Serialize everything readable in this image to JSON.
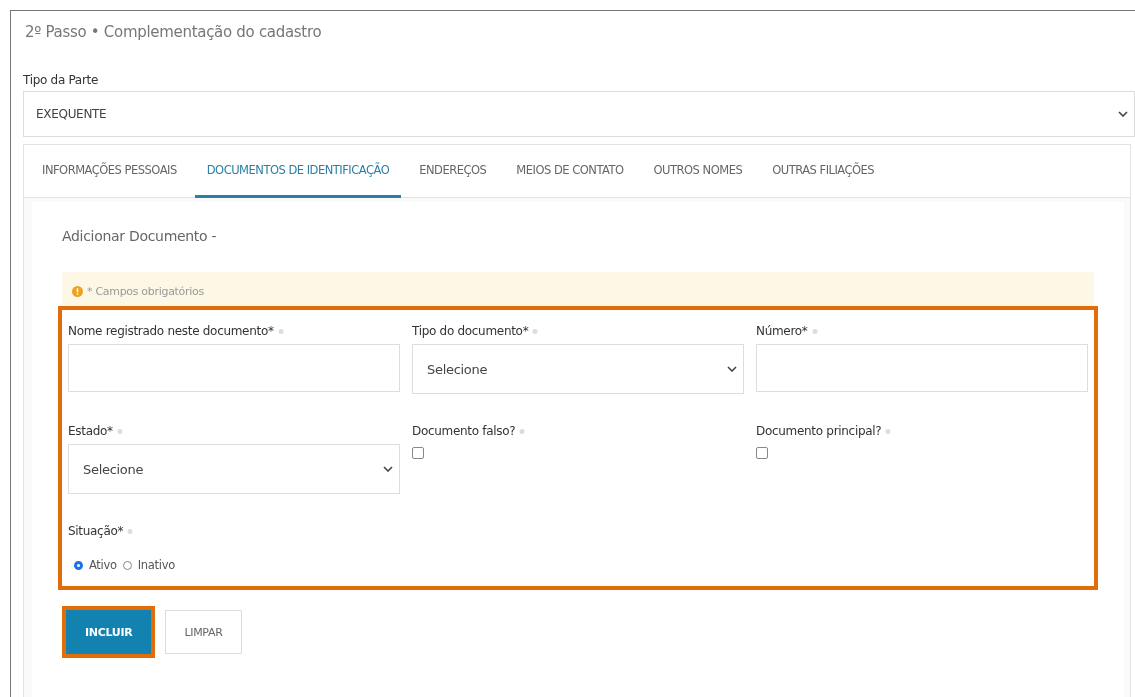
{
  "step_title": "2º Passo • Complementação do cadastro",
  "party_type": {
    "label": "Tipo da Parte",
    "value": "EXEQUENTE"
  },
  "tabs": [
    {
      "label": "INFORMAÇÕES PESSOAIS",
      "selected": false
    },
    {
      "label": "DOCUMENTOS DE IDENTIFICAÇÃO",
      "selected": true
    },
    {
      "label": "ENDEREÇOS",
      "selected": false
    },
    {
      "label": "MEIOS DE CONTATO",
      "selected": false
    },
    {
      "label": "OUTROS NOMES",
      "selected": false
    },
    {
      "label": "OUTRAS FILIAÇÕES",
      "selected": false
    }
  ],
  "card_title": "Adicionar Documento -",
  "notice": "* Campos obrigatórios",
  "fields": [
    {
      "kind": "text",
      "label": "Nome registrado neste documento*"
    },
    {
      "kind": "select",
      "label": "Tipo do documento*",
      "value": "Selecione"
    },
    {
      "kind": "text",
      "label": "Número*"
    },
    {
      "kind": "select",
      "label": "Estado*",
      "value": "Selecione"
    },
    {
      "kind": "checkbox",
      "label": "Documento falso?",
      "checked": false
    },
    {
      "kind": "checkbox",
      "label": "Documento principal?",
      "checked": false
    },
    {
      "kind": "radio",
      "label": "Situação*",
      "options": [
        {
          "label": "Ativo",
          "selected": true
        },
        {
          "label": "Inativo",
          "selected": false
        }
      ]
    }
  ],
  "buttons": [
    {
      "label": "INCLUIR",
      "kind": "primary"
    },
    {
      "label": "LIMPAR",
      "kind": "secondary"
    }
  ]
}
